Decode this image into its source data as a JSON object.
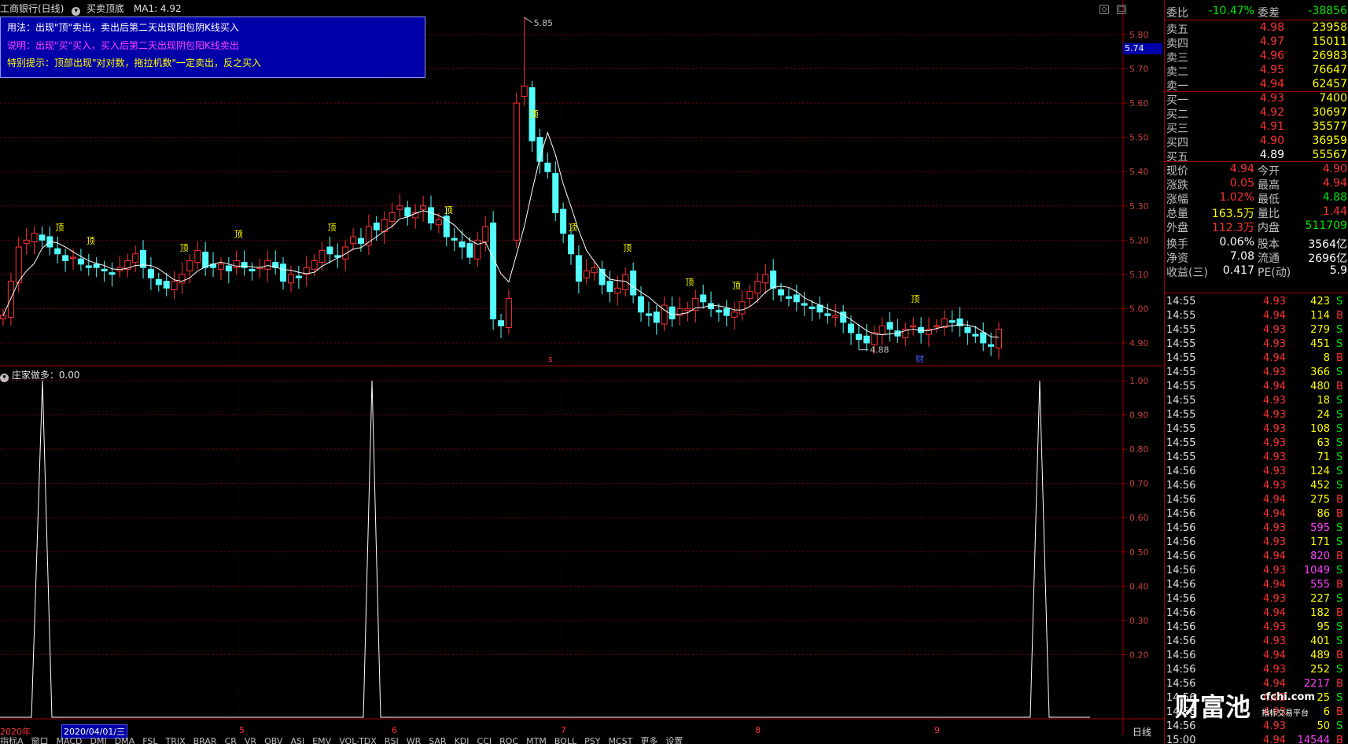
{
  "window": {
    "stock_title": "工商银行(日线)",
    "indicator_name": "买卖顶底",
    "ma_label": "MA1: 4.92"
  },
  "info_box": {
    "line1": "用法：出现\"顶\"卖出，卖出后第二天出现阳包阴K线买入",
    "line2": "说明：出现\"买\"买入，买入后第二天出现阴包阳K线卖出",
    "line3": "特别提示：顶部出现\"对对数，拖拉机数\"一定卖出，反之买入"
  },
  "price_chart": {
    "y_ticks": [
      "5.80",
      "5.70",
      "5.60",
      "5.50",
      "5.40",
      "5.30",
      "5.20",
      "5.10",
      "5.00",
      "4.90"
    ],
    "current_price_flag": "5.74",
    "high_label": "5.85",
    "low_label": "4.88",
    "marker_top": "顶",
    "marker_s": "s",
    "marker_cai": "财"
  },
  "sub_chart": {
    "title": "庄家做多：0.00",
    "y_ticks": [
      "1.00",
      "0.90",
      "0.80",
      "0.70",
      "0.60",
      "0.50",
      "0.40",
      "0.30",
      "0.20"
    ]
  },
  "date_axis": {
    "year": "2020年",
    "selected_date": "2020/04/01/三",
    "months": [
      "5",
      "6",
      "7",
      "8",
      "9"
    ],
    "period": "日线"
  },
  "bottom_tabs": [
    "指标A",
    "窗口",
    "MACD",
    "DMI",
    "DMA",
    "FSL",
    "TRIX",
    "BRAR",
    "CR",
    "VR",
    "OBV",
    "ASI",
    "EMV",
    "VOL-TDX",
    "RSI",
    "WR",
    "SAR",
    "KDJ",
    "CCI",
    "ROC",
    "MTM",
    "BOLL",
    "PSY",
    "MCST",
    "更多",
    "设置"
  ],
  "chart_data": {
    "type": "candlestick",
    "ylim": [
      4.85,
      5.88
    ],
    "note_high": 5.85,
    "note_low": 4.88,
    "ma_last": 4.92
  },
  "order_book": {
    "weibi_label": "委比",
    "weibi_value": "-10.47%",
    "weicha_label": "委差",
    "weicha_value": "-38856",
    "asks": [
      {
        "label": "卖五",
        "price": "4.98",
        "vol": "23958"
      },
      {
        "label": "卖四",
        "price": "4.97",
        "vol": "15011"
      },
      {
        "label": "卖三",
        "price": "4.96",
        "vol": "26983"
      },
      {
        "label": "卖二",
        "price": "4.95",
        "vol": "76647"
      },
      {
        "label": "卖一",
        "price": "4.94",
        "vol": "62457"
      }
    ],
    "bids": [
      {
        "label": "买一",
        "price": "4.93",
        "vol": "7400"
      },
      {
        "label": "买二",
        "price": "4.92",
        "vol": "30697"
      },
      {
        "label": "买三",
        "price": "4.91",
        "vol": "35577"
      },
      {
        "label": "买四",
        "price": "4.90",
        "vol": "36959"
      },
      {
        "label": "买五",
        "price": "4.89",
        "vol": "55567"
      }
    ]
  },
  "stats": [
    {
      "l1": "现价",
      "v1": "4.94",
      "c1": "red",
      "l2": "今开",
      "v2": "4.90",
      "c2": "red"
    },
    {
      "l1": "涨跌",
      "v1": "0.05",
      "c1": "red",
      "l2": "最高",
      "v2": "4.94",
      "c2": "red"
    },
    {
      "l1": "涨幅",
      "v1": "1.02%",
      "c1": "red",
      "l2": "最低",
      "v2": "4.88",
      "c2": "green"
    },
    {
      "l1": "总量",
      "v1": "163.5万",
      "c1": "yellow",
      "l2": "量比",
      "v2": "1.44",
      "c2": "red"
    },
    {
      "l1": "外盘",
      "v1": "112.3万",
      "c1": "red",
      "l2": "内盘",
      "v2": "511709",
      "c2": "green"
    },
    {
      "l1": "换手",
      "v1": "0.06%",
      "c1": "white",
      "l2": "股本",
      "v2": "3564亿",
      "c2": "white"
    },
    {
      "l1": "净资",
      "v1": "7.08",
      "c1": "white",
      "l2": "流通",
      "v2": "2696亿",
      "c2": "white"
    },
    {
      "l1": "收益(三)",
      "v1": "0.417",
      "c1": "white",
      "l2": "PE(动)",
      "v2": "5.9",
      "c2": "white"
    }
  ],
  "ticks": [
    {
      "t": "14:55",
      "p": "4.93",
      "v": "423",
      "bs": "S"
    },
    {
      "t": "14:55",
      "p": "4.94",
      "v": "114",
      "bs": "B"
    },
    {
      "t": "14:55",
      "p": "4.93",
      "v": "279",
      "bs": "S"
    },
    {
      "t": "14:55",
      "p": "4.93",
      "v": "451",
      "bs": "S"
    },
    {
      "t": "14:55",
      "p": "4.94",
      "v": "8",
      "bs": "B"
    },
    {
      "t": "14:55",
      "p": "4.93",
      "v": "366",
      "bs": "S"
    },
    {
      "t": "14:55",
      "p": "4.94",
      "v": "480",
      "bs": "B"
    },
    {
      "t": "14:55",
      "p": "4.93",
      "v": "18",
      "bs": "S"
    },
    {
      "t": "14:55",
      "p": "4.93",
      "v": "24",
      "bs": "S"
    },
    {
      "t": "14:55",
      "p": "4.93",
      "v": "108",
      "bs": "S"
    },
    {
      "t": "14:55",
      "p": "4.93",
      "v": "63",
      "bs": "S"
    },
    {
      "t": "14:55",
      "p": "4.93",
      "v": "71",
      "bs": "S"
    },
    {
      "t": "14:56",
      "p": "4.93",
      "v": "124",
      "bs": "S"
    },
    {
      "t": "14:56",
      "p": "4.93",
      "v": "452",
      "bs": "S"
    },
    {
      "t": "14:56",
      "p": "4.94",
      "v": "275",
      "bs": "B"
    },
    {
      "t": "14:56",
      "p": "4.94",
      "v": "86",
      "bs": "B"
    },
    {
      "t": "14:56",
      "p": "4.93",
      "v": "595",
      "bs": "S",
      "vc": "magenta"
    },
    {
      "t": "14:56",
      "p": "4.93",
      "v": "171",
      "bs": "S"
    },
    {
      "t": "14:56",
      "p": "4.94",
      "v": "820",
      "bs": "B",
      "vc": "magenta"
    },
    {
      "t": "14:56",
      "p": "4.93",
      "v": "1049",
      "bs": "S",
      "vc": "magenta"
    },
    {
      "t": "14:56",
      "p": "4.94",
      "v": "555",
      "bs": "B",
      "vc": "magenta"
    },
    {
      "t": "14:56",
      "p": "4.93",
      "v": "227",
      "bs": "S"
    },
    {
      "t": "14:56",
      "p": "4.94",
      "v": "182",
      "bs": "B"
    },
    {
      "t": "14:56",
      "p": "4.93",
      "v": "95",
      "bs": "S"
    },
    {
      "t": "14:56",
      "p": "4.93",
      "v": "401",
      "bs": "S"
    },
    {
      "t": "14:56",
      "p": "4.94",
      "v": "489",
      "bs": "B"
    },
    {
      "t": "14:56",
      "p": "4.93",
      "v": "252",
      "bs": "S"
    },
    {
      "t": "14:56",
      "p": "4.94",
      "v": "2217",
      "bs": "B",
      "vc": "magenta"
    },
    {
      "t": "14:56",
      "p": "4.93",
      "v": "25",
      "bs": "S"
    },
    {
      "t": "14:56",
      "p": "4.93",
      "v": "6",
      "bs": "B"
    },
    {
      "t": "14:56",
      "p": "4.93",
      "v": "50",
      "bs": "S"
    },
    {
      "t": "15:00",
      "p": "4.94",
      "v": "14544",
      "bs": "B",
      "vc": "magenta"
    }
  ],
  "watermark": {
    "brand": "财富池",
    "domain": "cfchi.com",
    "slogan": "指标交易平台"
  },
  "colors": {
    "up": "#ff3232",
    "down": "#54ffff",
    "grid": "#800000",
    "ma": "#ffffff",
    "marker": "#ffff00"
  }
}
